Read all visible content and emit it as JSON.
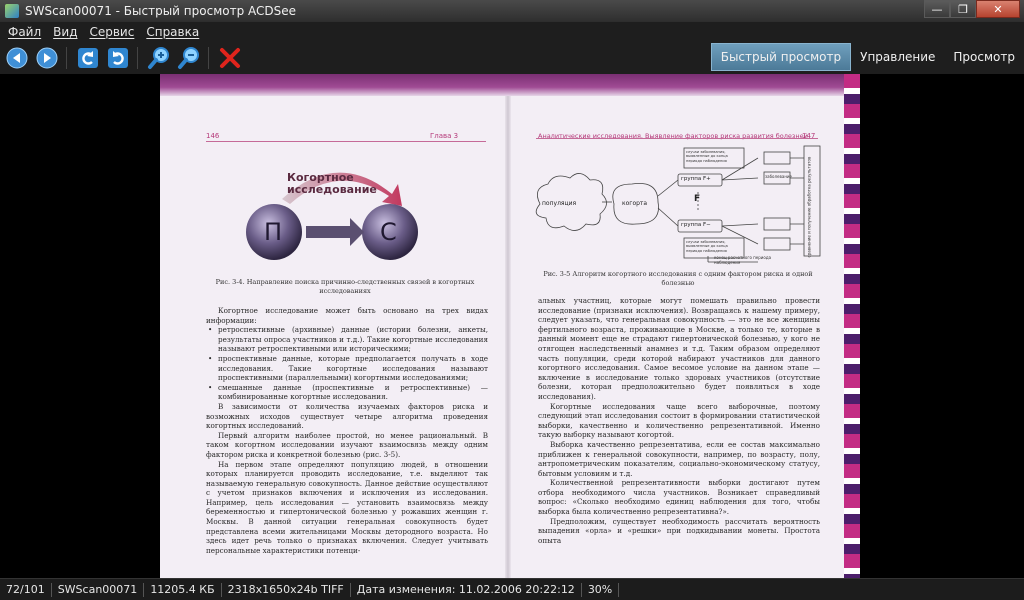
{
  "window": {
    "title": "SWScan00071 - Быстрый просмотр ACDSee",
    "minimize": "—",
    "maximize": "❐",
    "close": "✕"
  },
  "menu": [
    "Файл",
    "Вид",
    "Сервис",
    "Справка"
  ],
  "toolbar": {
    "icons": [
      "back-arrow-icon",
      "forward-arrow-icon",
      "rotate-left-icon",
      "rotate-right-icon",
      "zoom-in-icon",
      "zoom-out-icon",
      "delete-icon"
    ]
  },
  "mode_tabs": {
    "active": "Быстрый просмотр",
    "manage": "Управление",
    "view": "Просмотр"
  },
  "document": {
    "left": {
      "page_number": "146",
      "chapter": "Глава 3",
      "diagram_title": "Когортное исследование",
      "circle_left": "П",
      "circle_right": "С",
      "caption": "Рис. 3-4. Направление поиска причинно-следственных связей в когортных исследованиях",
      "intro": "Когортное исследование может быть основано на трех видах информации:",
      "bullets": [
        "ретроспективные (архивные) данные (истории болезни, анкеты, результаты опроса участников и т.д.). Такие когортные исследования называют ретроспективными или историческими;",
        "проспективные данные, которые предполагается получать в ходе исследования. Такие когортные исследования называют проспективными (параллельными) когортными исследованиями;",
        "смешанные данные (проспективные и ретроспективные) — комбинированные когортные исследования."
      ],
      "paragraphs": [
        "В зависимости от количества изучаемых факторов риска и возможных исходов существует четыре алгоритма проведения когортных исследований.",
        "Первый алгоритм наиболее простой, но менее рациональный. В таком когортном исследовании изучают взаимосвязь между одним фактором риска и конкретной болезнью (рис. 3-5).",
        "На первом этапе определяют популяцию людей, в отношении которых планируется проводить исследование, т.е. выделяют так называемую генеральную совокупность. Данное действие осуществляют с учетом признаков включения и исключения из исследования. Например, цель исследования — установить взаимосвязь между беременностью и гипертонической болезнью у рожавших женщин г. Москвы. В данной ситуации генеральная совокупность будет представлена всеми жительницами Москвы детородного возраста. Но здесь идет речь только о признаках включения. Следует учитывать персональные характеристики потенци-"
      ]
    },
    "right": {
      "header": "Аналитические исследования. Выявление факторов риска развития болезней",
      "page_number": "147",
      "diagram": {
        "population": "популяция",
        "cohort": "когорта",
        "group_plus": "группа F+",
        "group_minus": "группа F−",
        "factor": "F",
        "side_label": "сравнение и получение обработка результатов",
        "box1": "случаи заболевания, выявленные до конца периода наблюдения",
        "box2": "случаи заболевания, выявленные до конца периода наблюдения",
        "ill": "заболевание",
        "end_label": "конец расчетного периода наблюдения"
      },
      "caption": "Рис. 3-5 Алгоритм когортного исследования с одним фактором риска и одной болезнью",
      "paragraphs": [
        "альных участниц, которые могут помешать правильно провести исследование (признаки исключения). Возвращаясь к нашему примеру, следует указать, что генеральная совокупность — это не все женщины фертильного возраста, проживающие в Москве, а только те, которые в данный момент еще не страдают гипертонической болезнью, у кого не отягощен наследственный анамнез и т.д. Таким образом определяют часть популяции, среди которой набирают участников для данного когортного исследования. Самое весомое условие на данном этапе — включение в исследование только здоровых участников (отсутствие болезни, которая предположительно будет появляться в ходе исследования).",
        "Когортные исследования чаще всего выборочные, поэтому следующий этап исследования состоит в формировании статистической выборки, качественно и количественно репрезентативной. Именно такую выборку называют когортой.",
        "Выборка качественно репрезентатива, если ее состав максимально приближен к генеральной совокупности, например, по возрасту, полу, антропометрическим показателям, социально-экономическому статусу, бытовым условиям и т.д.",
        "Количественной репрезентативности выборки достигают путем отбора необходимого числа участников. Возникает справедливый вопрос: «Сколько необходимо единиц наблюдения для того, чтобы выборка была количественно репрезентативна?».",
        "Предположим, существует необходимость рассчитать вероятность выпадения «орла» и «решки» при подкидывании монеты. Простота опыта"
      ]
    }
  },
  "status": {
    "position": "72/101",
    "filename": "SWScan00071",
    "size": "11205.4 КБ",
    "dimensions": "2318x1650x24b TIFF",
    "modified": "Дата изменения: 11.02.2006 20:22:12",
    "zoom": "30%"
  }
}
